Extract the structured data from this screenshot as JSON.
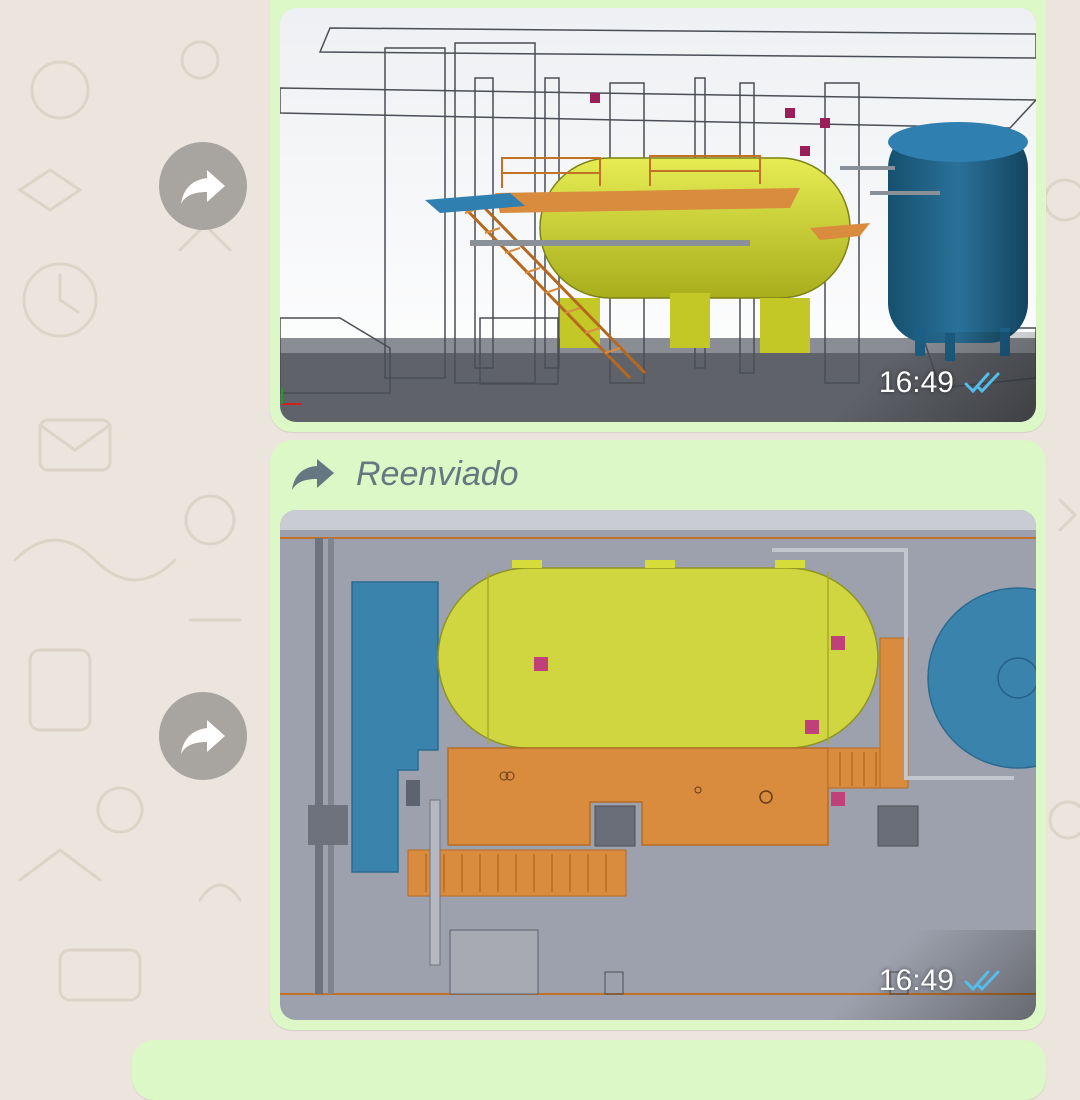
{
  "chat": {
    "background_color": "#ece5dd",
    "bubble_color": "#dcf8c6",
    "forward_button_icon": "forward-arrow-icon"
  },
  "messages": [
    {
      "type": "image",
      "image_description": "isometric 3D render of a skid with horizontal yellow tank, blue vertical vessel, orange stairs and platform",
      "time": "16:49",
      "status_icon": "double-check-read-icon",
      "status_color": "#53bdeb"
    },
    {
      "type": "image",
      "forwarded_label": "Reenviado",
      "forwarded_icon": "forwarded-arrow-icon",
      "image_description": "top view of the same skid layout",
      "time": "16:49",
      "status_icon": "double-check-read-icon",
      "status_color": "#53bdeb"
    }
  ],
  "colors": {
    "tank_yellow": "#d6dc3a",
    "vessel_blue": "#1c5f86",
    "platform_orange": "#d98b3e",
    "panel_blue": "#3a83ad",
    "accent_magenta": "#c0407a"
  }
}
